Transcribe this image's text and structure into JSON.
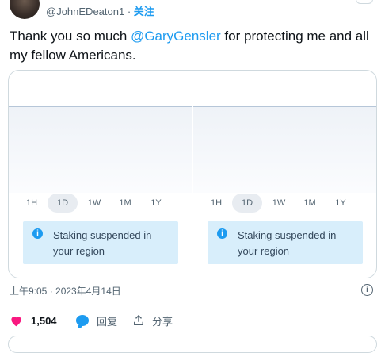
{
  "header": {
    "handle": "@JohnEDeaton1",
    "separator": " · ",
    "follow_label": "关注"
  },
  "tweet": {
    "text_before": "Thank you so much ",
    "mention": "@GaryGensler",
    "text_after": " for protecting me and all my fellow Americans."
  },
  "media": {
    "panels": [
      {
        "timeframes": [
          "1H",
          "1D",
          "1W",
          "1M",
          "1Y"
        ],
        "active_timeframe": "1D",
        "notice_icon": "info-icon",
        "notice_text": "Staking suspended in your region"
      },
      {
        "timeframes": [
          "1H",
          "1D",
          "1W",
          "1M",
          "1Y"
        ],
        "active_timeframe": "1D",
        "notice_icon": "info-icon",
        "notice_text": "Staking suspended in your region"
      }
    ]
  },
  "meta": {
    "timestamp": "上午9:05 · 2023年4月14日",
    "info_glyph": "i"
  },
  "actions": {
    "like_count": "1,504",
    "reply_label": "回复",
    "share_label": "分享"
  },
  "colors": {
    "accent": "#1d9bf0",
    "like": "#f91880",
    "notice_bg": "#d8eefb"
  }
}
